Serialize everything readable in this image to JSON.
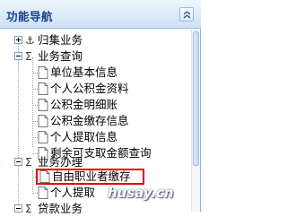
{
  "panel": {
    "title": "功能导航",
    "collapse_icon": "double-chevron-up-icon"
  },
  "tree": {
    "nodes": [
      {
        "label": "归集业务",
        "type": "group",
        "state": "collapsed",
        "symbol": "⚓"
      },
      {
        "label": "业务查询",
        "type": "group",
        "state": "expanded",
        "symbol": "Σ"
      },
      {
        "label": "单位基本信息",
        "type": "leaf"
      },
      {
        "label": "个人公积金资料",
        "type": "leaf"
      },
      {
        "label": "公积金明细账",
        "type": "leaf"
      },
      {
        "label": "公积金缴存信息",
        "type": "leaf"
      },
      {
        "label": "个人提取信息",
        "type": "leaf"
      },
      {
        "label": "剩余可支取金额查询",
        "type": "leaf"
      },
      {
        "label": "业务办理",
        "type": "group",
        "state": "expanded",
        "symbol": "Σ"
      },
      {
        "label": "自由职业者缴存",
        "type": "leaf",
        "highlighted": true
      },
      {
        "label": "个人提取",
        "type": "leaf"
      },
      {
        "label": "贷款业务",
        "type": "group",
        "state": "expanded",
        "symbol": "Σ"
      }
    ]
  },
  "highlight_color": "#e30000",
  "watermark": "husay.cn"
}
